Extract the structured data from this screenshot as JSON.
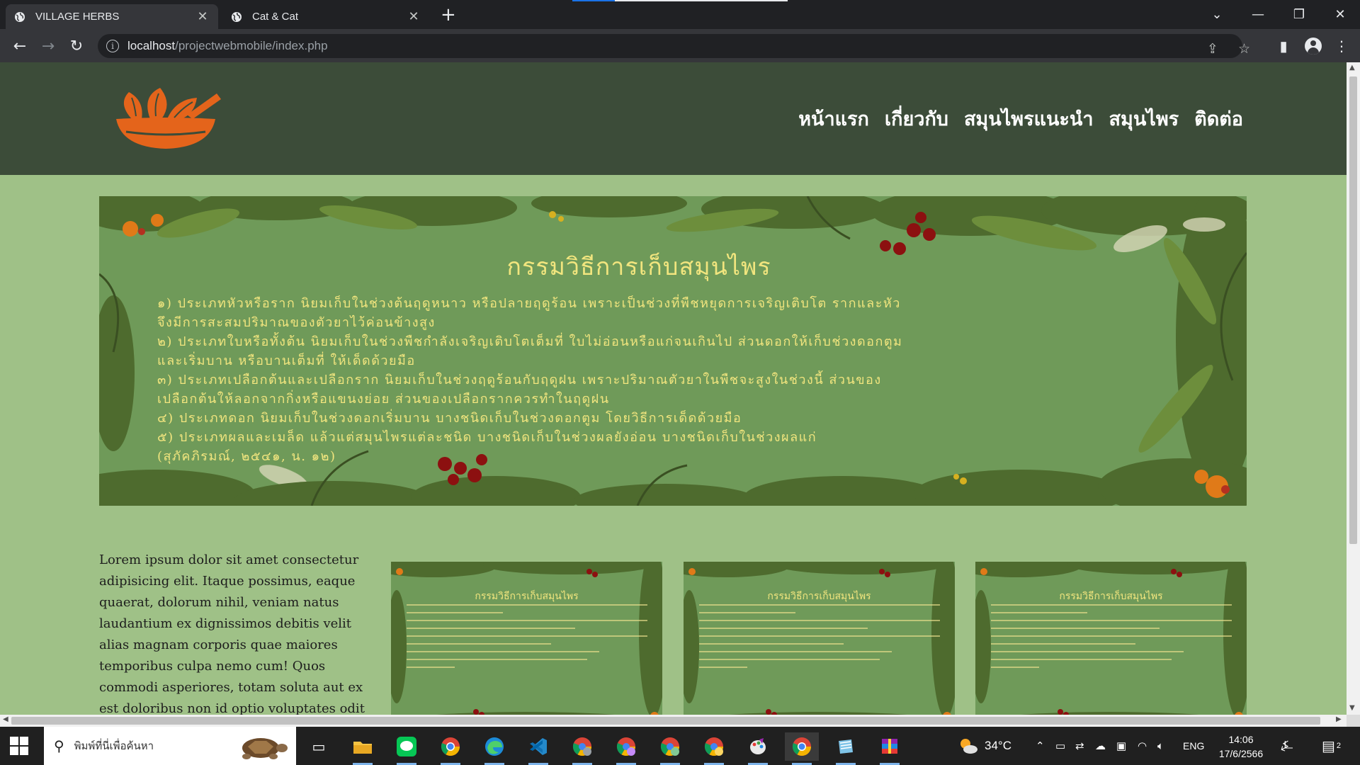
{
  "browser": {
    "tabs": [
      {
        "title": "VILLAGE HERBS",
        "active": true
      },
      {
        "title": "Cat & Cat",
        "active": false
      }
    ],
    "url_host": "localhost",
    "url_path": "/projectwebmobile/index.php"
  },
  "site": {
    "nav": [
      "หน้าแรก",
      "เกี่ยวกับ",
      "สมุนไพรแนะนำ",
      "สมุนไพร",
      "ติดต่อ"
    ],
    "logo_alt": "logo-icon",
    "banner": {
      "title": "กรรมวิธีการเก็บสมุนไพร",
      "lines": [
        "๑) ประเภทหัวหรือราก นิยมเก็บในช่วงต้นฤดูหนาว หรือปลายฤดูร้อน เพราะเป็นช่วงที่พืชหยุดการเจริญเติบโต รากและหัว",
        "จึงมีการสะสมปริมาณของตัวยาไว้ค่อนข้างสูง",
        " ๒) ประเภทใบหรือทั้งต้น นิยมเก็บในช่วงพืชกำลังเจริญเติบโตเต็มที่ ใบไม่อ่อนหรือแก่จนเกินไป ส่วนดอกให้เก็บช่วงดอกตูม",
        " และเริ่มบาน หรือบานเต็มที่ ให้เด็ดด้วยมือ",
        "๓) ประเภทเปลือกต้นและเปลือกราก นิยมเก็บในช่วงฤดูร้อนกับฤดูฝน เพราะปริมาณตัวยาในพืชจะสูงในช่วงนี้ ส่วนของ",
        "เปลือกต้นให้ลอกจากกิ่งหรือแขนงย่อย ส่วนของเปลือกรากควรทำในฤดูฝน",
        "๔) ประเภทดอก นิยมเก็บในช่วงดอกเริ่มบาน บางชนิดเก็บในช่วงดอกตูม โดยวิธีการเด็ดด้วยมือ",
        "๕) ประเภทผลและเมล็ด แล้วแต่สมุนไพรแต่ละชนิด บางชนิดเก็บในช่วงผลยังอ่อน บางชนิดเก็บในช่วงผลแก่",
        "(สุภัคภิรมณ์, ๒๕๔๑, น. ๑๒)"
      ]
    },
    "intro_text": "Lorem ipsum dolor sit amet consectetur adipisicing elit. Itaque possimus, eaque quaerat, dolorum nihil, veniam natus laudantium ex dignissimos debitis velit alias magnam corporis quae maiores temporibus culpa nemo cum! Quos commodi asperiores, totam soluta aut ex est doloribus non id optio voluptates odit official Quidem est",
    "thumbnails": [
      {
        "title": "กรรมวิธีการเก็บสมุนไพร"
      },
      {
        "title": "กรรมวิธีการเก็บสมุนไพร"
      },
      {
        "title": "กรรมวิธีการเก็บสมุนไพร"
      }
    ]
  },
  "taskbar": {
    "search_placeholder": "พิมพ์ที่นี่เพื่อค้นหา",
    "weather": "34°C",
    "language": "ENG",
    "time": "14:06",
    "date": "17/6/2566",
    "notification_count": "2",
    "apps": [
      "file-explorer-icon",
      "line-icon",
      "chrome-icon",
      "edge-icon",
      "vscode-icon",
      "chrome-profile-icon",
      "chrome-profile-icon",
      "chrome-profile-icon",
      "chrome-profile-icon",
      "paint-icon",
      "chrome-icon",
      "notepad-icon",
      "winrar-icon"
    ]
  },
  "colors": {
    "header_bg": "#3c4c39",
    "page_bg": "#9fc187",
    "banner_text": "#f1e57e",
    "logo": "#e4641b"
  }
}
